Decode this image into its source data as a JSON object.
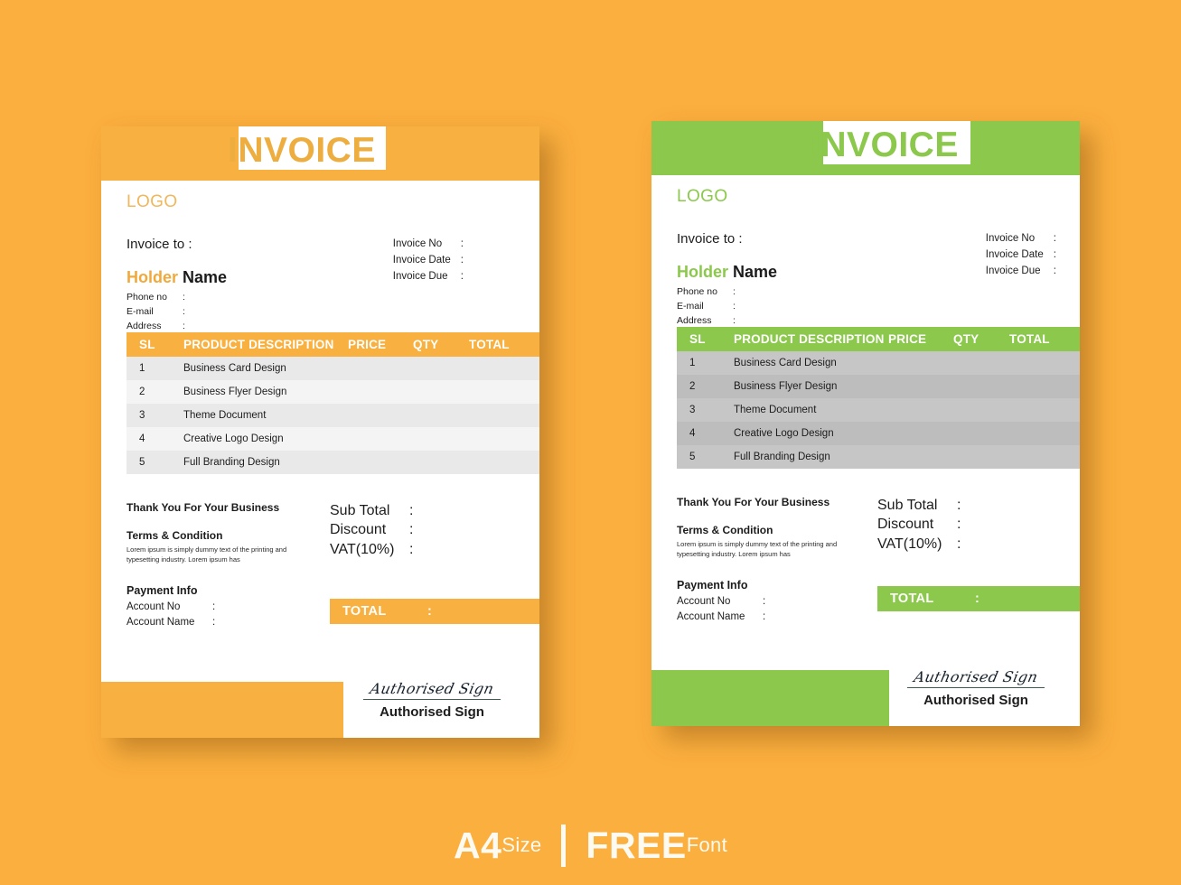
{
  "background_color": "#fbaf3e",
  "caption": {
    "size_value": "A4",
    "size_word": "Size",
    "free_word": "FREE",
    "font_word": "Font"
  },
  "invoices": [
    {
      "variant": "orange",
      "accent_color": "#f8b040",
      "title": "INVOICE",
      "logo": "LOGO",
      "invoice_to_label": "Invoice to :",
      "holder_accent": "Holder",
      "holder_rest": " Name",
      "contact": [
        {
          "label": "Phone no",
          "sep": ":"
        },
        {
          "label": "E-mail",
          "sep": ":"
        },
        {
          "label": "Address",
          "sep": ":"
        }
      ],
      "meta": [
        {
          "label": "Invoice No",
          "sep": ":"
        },
        {
          "label": "Invoice Date",
          "sep": ":"
        },
        {
          "label": "Invoice Due",
          "sep": ":"
        }
      ],
      "table": {
        "columns": [
          "SL",
          "PRODUCT DESCRIPTION",
          "PRICE",
          "QTY",
          "TOTAL"
        ],
        "rows": [
          {
            "sl": "1",
            "description": "Business Card Design",
            "price": "",
            "qty": "",
            "total": ""
          },
          {
            "sl": "2",
            "description": "Business Flyer Design",
            "price": "",
            "qty": "",
            "total": ""
          },
          {
            "sl": "3",
            "description": "Theme Document",
            "price": "",
            "qty": "",
            "total": ""
          },
          {
            "sl": "4",
            "description": "Creative Logo Design",
            "price": "",
            "qty": "",
            "total": ""
          },
          {
            "sl": "5",
            "description": "Full Branding Design",
            "price": "",
            "qty": "",
            "total": ""
          }
        ]
      },
      "thanks": "Thank You For Your Business",
      "terms_title": "Terms & Condition",
      "terms_body": "Lorem ipsum is simply dummy text of the printing and typesetting industry. Lorem ipsum has",
      "payment_title": "Payment Info",
      "payment": [
        {
          "label": "Account No",
          "sep": ":"
        },
        {
          "label": "Account Name",
          "sep": ":"
        }
      ],
      "sums": [
        {
          "label": "Sub Total",
          "sep": ":"
        },
        {
          "label": "Discount",
          "sep": ":"
        },
        {
          "label": "VAT(10%)",
          "sep": ":"
        }
      ],
      "total_label": "TOTAL",
      "total_sep": ":",
      "signature_script": "Authorised Sign",
      "signature_label": "Authorised Sign"
    },
    {
      "variant": "green",
      "accent_color": "#8bc84b",
      "title": "INVOICE",
      "logo": "LOGO",
      "invoice_to_label": "Invoice to :",
      "holder_accent": "Holder",
      "holder_rest": " Name",
      "contact": [
        {
          "label": "Phone no",
          "sep": ":"
        },
        {
          "label": "E-mail",
          "sep": ":"
        },
        {
          "label": "Address",
          "sep": ":"
        }
      ],
      "meta": [
        {
          "label": "Invoice No",
          "sep": ":"
        },
        {
          "label": "Invoice Date",
          "sep": ":"
        },
        {
          "label": "Invoice Due",
          "sep": ":"
        }
      ],
      "table": {
        "columns": [
          "SL",
          "PRODUCT DESCRIPTION",
          "PRICE",
          "QTY",
          "TOTAL"
        ],
        "rows": [
          {
            "sl": "1",
            "description": "Business Card Design",
            "price": "",
            "qty": "",
            "total": ""
          },
          {
            "sl": "2",
            "description": "Business Flyer Design",
            "price": "",
            "qty": "",
            "total": ""
          },
          {
            "sl": "3",
            "description": "Theme Document",
            "price": "",
            "qty": "",
            "total": ""
          },
          {
            "sl": "4",
            "description": "Creative Logo Design",
            "price": "",
            "qty": "",
            "total": ""
          },
          {
            "sl": "5",
            "description": "Full Branding Design",
            "price": "",
            "qty": "",
            "total": ""
          }
        ]
      },
      "thanks": "Thank You For Your Business",
      "terms_title": "Terms & Condition",
      "terms_body": "Lorem ipsum is simply dummy text of the printing and typesetting industry. Lorem ipsum has",
      "payment_title": "Payment Info",
      "payment": [
        {
          "label": "Account No",
          "sep": ":"
        },
        {
          "label": "Account Name",
          "sep": ":"
        }
      ],
      "sums": [
        {
          "label": "Sub Total",
          "sep": ":"
        },
        {
          "label": "Discount",
          "sep": ":"
        },
        {
          "label": "VAT(10%)",
          "sep": ":"
        }
      ],
      "total_label": "TOTAL",
      "total_sep": ":",
      "signature_script": "Authorised Sign",
      "signature_label": "Authorised Sign"
    }
  ]
}
